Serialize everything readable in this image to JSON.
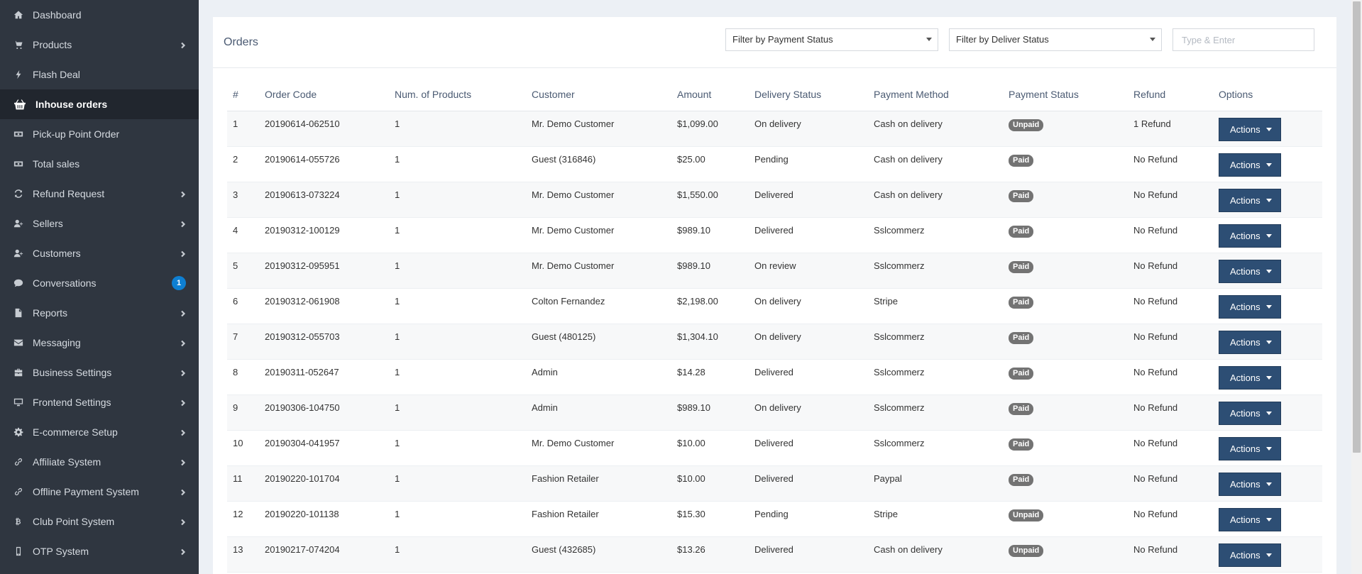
{
  "sidebar": {
    "items": [
      {
        "label": "Dashboard",
        "icon": "home-icon",
        "arrow": false,
        "active": false
      },
      {
        "label": "Products",
        "icon": "cart-icon",
        "arrow": true,
        "active": false
      },
      {
        "label": "Flash Deal",
        "icon": "bolt-icon",
        "arrow": false,
        "active": false
      },
      {
        "label": "Inhouse orders",
        "icon": "basket-icon",
        "arrow": false,
        "active": true
      },
      {
        "label": "Pick-up Point Order",
        "icon": "money-icon",
        "arrow": false,
        "active": false
      },
      {
        "label": "Total sales",
        "icon": "money-icon",
        "arrow": false,
        "active": false
      },
      {
        "label": "Refund Request",
        "icon": "refresh-icon",
        "arrow": true,
        "active": false
      },
      {
        "label": "Sellers",
        "icon": "user-plus-icon",
        "arrow": true,
        "active": false
      },
      {
        "label": "Customers",
        "icon": "user-plus-icon",
        "arrow": true,
        "active": false
      },
      {
        "label": "Conversations",
        "icon": "chat-icon",
        "arrow": false,
        "active": false,
        "badge": "1"
      },
      {
        "label": "Reports",
        "icon": "file-icon",
        "arrow": true,
        "active": false
      },
      {
        "label": "Messaging",
        "icon": "envelope-icon",
        "arrow": true,
        "active": false
      },
      {
        "label": "Business Settings",
        "icon": "briefcase-icon",
        "arrow": true,
        "active": false
      },
      {
        "label": "Frontend Settings",
        "icon": "desktop-icon",
        "arrow": true,
        "active": false
      },
      {
        "label": "E-commerce Setup",
        "icon": "gear-icon",
        "arrow": true,
        "active": false
      },
      {
        "label": "Affiliate System",
        "icon": "link-icon",
        "arrow": true,
        "active": false
      },
      {
        "label": "Offline Payment System",
        "icon": "link-icon",
        "arrow": true,
        "active": false
      },
      {
        "label": "Club Point System",
        "icon": "bitcoin-icon",
        "arrow": true,
        "active": false
      },
      {
        "label": "OTP System",
        "icon": "mobile-icon",
        "arrow": true,
        "active": false
      }
    ]
  },
  "panel": {
    "title": "Orders",
    "payment_filter": "Filter by Payment Status",
    "deliver_filter": "Filter by Deliver Status",
    "search_placeholder": "Type & Enter"
  },
  "table": {
    "columns": [
      "#",
      "Order Code",
      "Num. of Products",
      "Customer",
      "Amount",
      "Delivery Status",
      "Payment Method",
      "Payment Status",
      "Refund",
      "Options"
    ],
    "action_label": "Actions",
    "rows": [
      {
        "num": "1",
        "code": "20190614-062510",
        "products": "1",
        "customer": "Mr. Demo Customer",
        "amount": "$1,099.00",
        "delivery": "On delivery",
        "method": "Cash on delivery",
        "payment": "Unpaid",
        "refund": "1 Refund"
      },
      {
        "num": "2",
        "code": "20190614-055726",
        "products": "1",
        "customer": "Guest (316846)",
        "amount": "$25.00",
        "delivery": "Pending",
        "method": "Cash on delivery",
        "payment": "Paid",
        "refund": "No Refund"
      },
      {
        "num": "3",
        "code": "20190613-073224",
        "products": "1",
        "customer": "Mr. Demo Customer",
        "amount": "$1,550.00",
        "delivery": "Delivered",
        "method": "Cash on delivery",
        "payment": "Paid",
        "refund": "No Refund"
      },
      {
        "num": "4",
        "code": "20190312-100129",
        "products": "1",
        "customer": "Mr. Demo Customer",
        "amount": "$989.10",
        "delivery": "Delivered",
        "method": "Sslcommerz",
        "payment": "Paid",
        "refund": "No Refund"
      },
      {
        "num": "5",
        "code": "20190312-095951",
        "products": "1",
        "customer": "Mr. Demo Customer",
        "amount": "$989.10",
        "delivery": "On review",
        "method": "Sslcommerz",
        "payment": "Paid",
        "refund": "No Refund"
      },
      {
        "num": "6",
        "code": "20190312-061908",
        "products": "1",
        "customer": "Colton Fernandez",
        "amount": "$2,198.00",
        "delivery": "On delivery",
        "method": "Stripe",
        "payment": "Paid",
        "refund": "No Refund"
      },
      {
        "num": "7",
        "code": "20190312-055703",
        "products": "1",
        "customer": "Guest (480125)",
        "amount": "$1,304.10",
        "delivery": "On delivery",
        "method": "Sslcommerz",
        "payment": "Paid",
        "refund": "No Refund"
      },
      {
        "num": "8",
        "code": "20190311-052647",
        "products": "1",
        "customer": "Admin",
        "amount": "$14.28",
        "delivery": "Delivered",
        "method": "Sslcommerz",
        "payment": "Paid",
        "refund": "No Refund"
      },
      {
        "num": "9",
        "code": "20190306-104750",
        "products": "1",
        "customer": "Admin",
        "amount": "$989.10",
        "delivery": "On delivery",
        "method": "Sslcommerz",
        "payment": "Paid",
        "refund": "No Refund"
      },
      {
        "num": "10",
        "code": "20190304-041957",
        "products": "1",
        "customer": "Mr. Demo Customer",
        "amount": "$10.00",
        "delivery": "Delivered",
        "method": "Sslcommerz",
        "payment": "Paid",
        "refund": "No Refund"
      },
      {
        "num": "11",
        "code": "20190220-101704",
        "products": "1",
        "customer": "Fashion Retailer",
        "amount": "$10.00",
        "delivery": "Delivered",
        "method": "Paypal",
        "payment": "Paid",
        "refund": "No Refund"
      },
      {
        "num": "12",
        "code": "20190220-101138",
        "products": "1",
        "customer": "Fashion Retailer",
        "amount": "$15.30",
        "delivery": "Pending",
        "method": "Stripe",
        "payment": "Unpaid",
        "refund": "No Refund"
      },
      {
        "num": "13",
        "code": "20190217-074204",
        "products": "1",
        "customer": "Guest (432685)",
        "amount": "$13.26",
        "delivery": "Delivered",
        "method": "Cash on delivery",
        "payment": "Unpaid",
        "refund": "No Refund"
      }
    ]
  },
  "colors": {
    "sidebar_bg": "#2f3640",
    "sidebar_active_bg": "#21262e",
    "action_button": "#2d4e74",
    "status_pill": "#737373",
    "badge": "#0e7fd2"
  }
}
